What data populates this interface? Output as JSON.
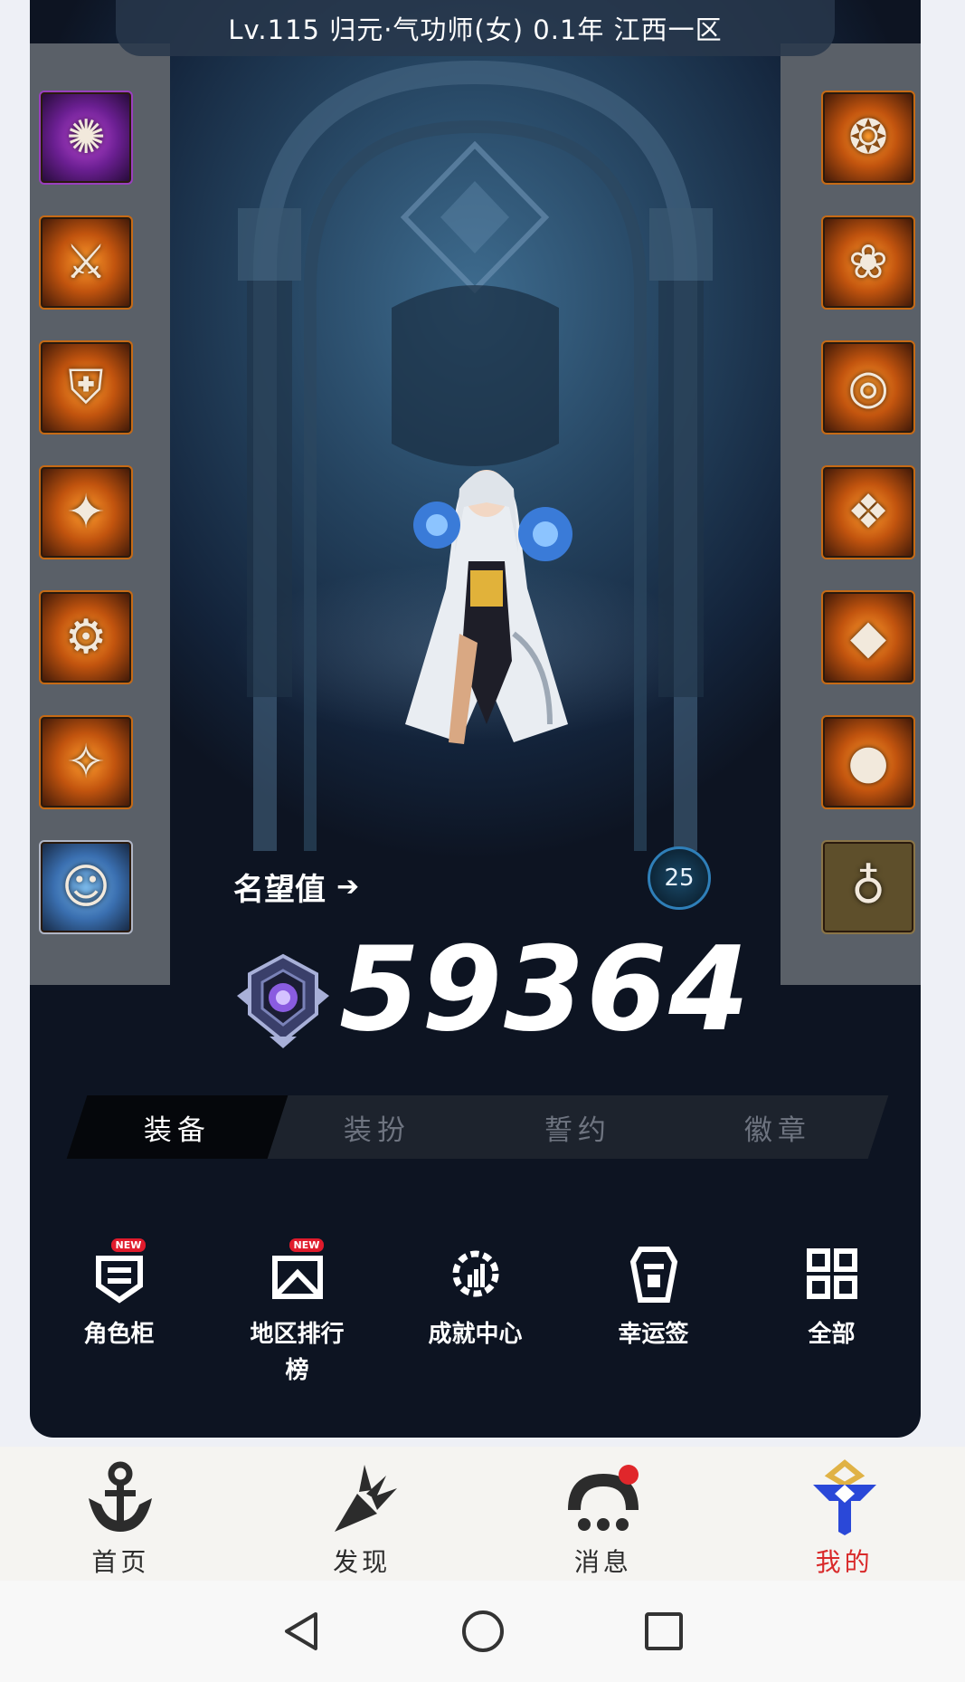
{
  "header": {
    "title": "Lv.115 归元·气功师(女) 0.1年 江西一区"
  },
  "equipment": {
    "left": [
      {
        "icon": "weapon-orb-icon",
        "glyph": "✺",
        "color": "purple"
      },
      {
        "icon": "shoulder-armor-icon",
        "glyph": "⚔",
        "color": "orange"
      },
      {
        "icon": "chest-armor-icon",
        "glyph": "⛨",
        "color": "orange"
      },
      {
        "icon": "leg-armor-icon",
        "glyph": "✦",
        "color": "orange"
      },
      {
        "icon": "belt-icon",
        "glyph": "⚙",
        "color": "orange"
      },
      {
        "icon": "boots-icon",
        "glyph": "✧",
        "color": "orange"
      },
      {
        "icon": "pet-portrait-icon",
        "glyph": "☺",
        "color": "blue"
      }
    ],
    "right": [
      {
        "icon": "bracelet-icon",
        "glyph": "❂",
        "color": "orange"
      },
      {
        "icon": "necklace-icon",
        "glyph": "❀",
        "color": "orange"
      },
      {
        "icon": "ring-icon",
        "glyph": "◎",
        "color": "orange"
      },
      {
        "icon": "sub-equipment-icon",
        "glyph": "❖",
        "color": "orange"
      },
      {
        "icon": "magic-stone-icon",
        "glyph": "◆",
        "color": "orange"
      },
      {
        "icon": "earring-icon",
        "glyph": "●",
        "color": "orange"
      },
      {
        "icon": "title-slot-icon",
        "glyph": "♁",
        "color": "dim"
      }
    ]
  },
  "fame": {
    "label": "名望值",
    "arrow": "➔",
    "value": "59364",
    "level_badge": "25"
  },
  "tabs": [
    {
      "label": "装备",
      "active": true
    },
    {
      "label": "装扮",
      "active": false
    },
    {
      "label": "誓约",
      "active": false
    },
    {
      "label": "徽章",
      "active": false
    }
  ],
  "shortcuts": [
    {
      "label": "角色柜",
      "icon": "wardrobe-icon",
      "badge": "NEW"
    },
    {
      "label": "地区排行榜",
      "icon": "ranking-icon",
      "badge": "NEW"
    },
    {
      "label": "成就中心",
      "icon": "achievement-icon",
      "badge": ""
    },
    {
      "label": "幸运签",
      "icon": "lucky-draw-icon",
      "badge": ""
    },
    {
      "label": "全部",
      "icon": "grid-icon",
      "badge": ""
    }
  ],
  "bottom_nav": [
    {
      "label": "首页",
      "icon": "anchor-home-icon",
      "active": false
    },
    {
      "label": "发现",
      "icon": "discover-icon",
      "active": false
    },
    {
      "label": "消息",
      "icon": "message-icon",
      "active": false,
      "dot": true
    },
    {
      "label": "我的",
      "icon": "profile-emblem-icon",
      "active": true
    }
  ],
  "colors": {
    "accent_red": "#d92a2a",
    "card_bg": "#0d1422",
    "tab_active_bg": "#05070b"
  }
}
